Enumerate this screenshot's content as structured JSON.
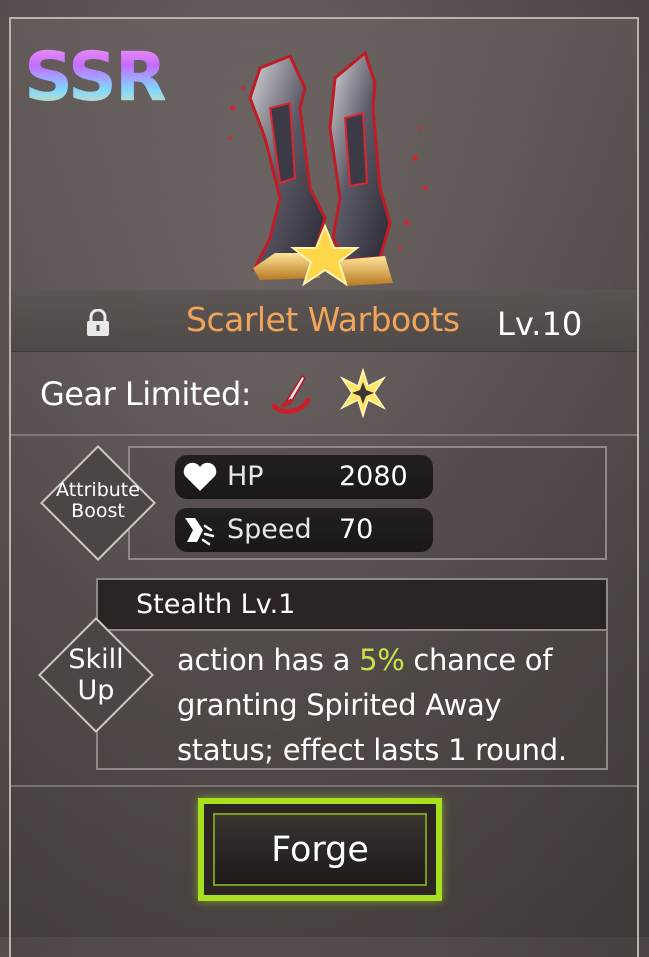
{
  "rarity": "SSR",
  "item": {
    "name": "Scarlet Warboots",
    "level": "Lv.10"
  },
  "gear_limited": {
    "label": "Gear Limited:"
  },
  "attribute_boost": {
    "label_line1": "Attribute",
    "label_line2": "Boost",
    "stats": [
      {
        "name": "HP",
        "value": "2080",
        "icon": "heart-icon"
      },
      {
        "name": "Speed",
        "value": "70",
        "icon": "speed-boot-icon"
      }
    ]
  },
  "skill_up": {
    "label_line1": "Skill",
    "label_line2": "Up",
    "skill_name": "Stealth Lv.1",
    "desc_before": "action has a ",
    "desc_highlight": "5%",
    "desc_after": " chance of granting Spirited Away status; effect lasts 1 round."
  },
  "forge_button": {
    "label": "Forge"
  },
  "colors": {
    "item_name": "#f0a55a",
    "highlight": "#c7e24a",
    "forge_border": "#a8e020"
  }
}
